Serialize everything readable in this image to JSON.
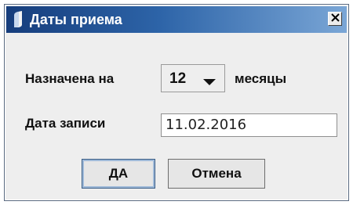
{
  "window": {
    "title": "Даты приема",
    "close_icon": "close-icon"
  },
  "form": {
    "assigned_label": "Назначена на",
    "months_value": "12",
    "months_unit": "месяцы",
    "record_date_label": "Дата записи",
    "record_date_value": "11.02.2016"
  },
  "buttons": {
    "ok_label": "ДА",
    "cancel_label": "Отмена"
  },
  "colors": {
    "titlebar_start": "#163d7c",
    "titlebar_end": "#7aa6d6",
    "dialog_bg": "#eeeeee"
  }
}
